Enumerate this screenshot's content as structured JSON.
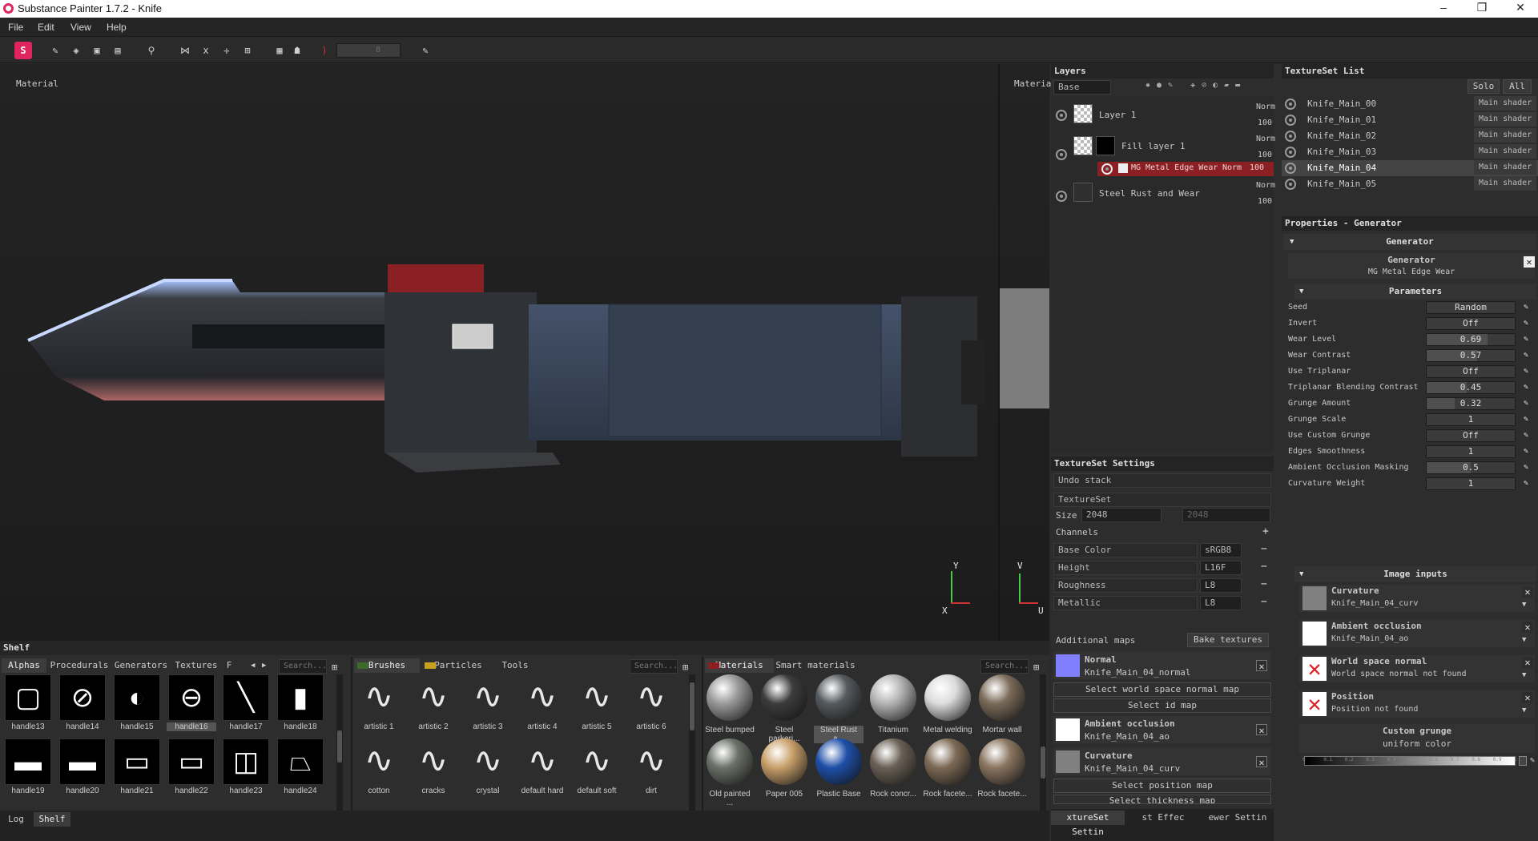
{
  "window": {
    "title": "Substance Painter 1.7.2 - Knife",
    "minimize": "–",
    "maximize": "❐",
    "close": "✕"
  },
  "menu": {
    "file": "File",
    "edit": "Edit",
    "view": "View",
    "help": "Help"
  },
  "toolbar": {
    "size_value": "8"
  },
  "viewport": {
    "left_label": "Material",
    "right_label": "Materia",
    "axis_y": "Y",
    "axis_x": "X",
    "axis_v": "V",
    "axis_u": "U"
  },
  "layers": {
    "title": "Layers",
    "channel": "Base Color",
    "items": [
      {
        "name": "Layer 1",
        "blend": "Norm",
        "opacity": "100"
      },
      {
        "name": "Fill layer 1",
        "blend": "Norm",
        "opacity": "100"
      },
      {
        "name": "MG Metal Edge Wear",
        "blend": "Norm",
        "opacity": "100"
      },
      {
        "name": "Steel Rust and Wear",
        "blend": "Norm",
        "opacity": "100"
      }
    ]
  },
  "textureset_list": {
    "title": "TextureSet List",
    "solo": "Solo",
    "all": "All",
    "items": [
      {
        "name": "Knife_Main_00",
        "shader": "Main shader"
      },
      {
        "name": "Knife_Main_01",
        "shader": "Main shader"
      },
      {
        "name": "Knife_Main_02",
        "shader": "Main shader"
      },
      {
        "name": "Knife_Main_03",
        "shader": "Main shader"
      },
      {
        "name": "Knife_Main_04",
        "shader": "Main shader"
      },
      {
        "name": "Knife_Main_05",
        "shader": "Main shader"
      }
    ]
  },
  "tss": {
    "title": "TextureSet Settings",
    "undo": "Undo stack",
    "textureset": "TextureSet",
    "size_label": "Size",
    "size": "2048",
    "size2": "2048",
    "channels_label": "Channels",
    "channels": [
      {
        "name": "Base Color",
        "format": "sRGB8"
      },
      {
        "name": "Height",
        "format": "L16F"
      },
      {
        "name": "Roughness",
        "format": "L8"
      },
      {
        "name": "Metallic",
        "format": "L8"
      }
    ],
    "additional": "Additional maps",
    "bake": "Bake textures",
    "maps": [
      {
        "title": "Normal",
        "file": "Knife_Main_04_normal",
        "color": "#7f7fff"
      },
      {
        "title": "Ambient occlusion",
        "file": "Knife_Main_04_ao",
        "color": "#ffffff"
      },
      {
        "title": "Curvature",
        "file": "Knife_Main_04_curv",
        "color": "#808080"
      }
    ],
    "select_wsn": "Select world space normal map",
    "select_id": "Select id map",
    "select_pos": "Select position map",
    "select_thick": "Select thickness map",
    "bottom_tabs": [
      "xtureSet Settin",
      "st Effec",
      "ewer Settin"
    ]
  },
  "props": {
    "title": "Properties - Generator",
    "generator_section": "Generator",
    "generator_label": "Generator",
    "generator_name": "MG Metal Edge Wear",
    "parameters": "Parameters",
    "params": [
      {
        "label": "Seed",
        "value": "Random",
        "level": 0
      },
      {
        "label": "Invert",
        "value": "Off",
        "level": 0
      },
      {
        "label": "Wear Level",
        "value": "0.69",
        "level": 0.69
      },
      {
        "label": "Wear Contrast",
        "value": "0.57",
        "level": 0.57
      },
      {
        "label": "Use Triplanar",
        "value": "Off",
        "level": 0
      },
      {
        "label": "Triplanar Blending Contrast",
        "value": "0.45",
        "level": 0.45
      },
      {
        "label": "Grunge Amount",
        "value": "0.32",
        "level": 0.32
      },
      {
        "label": "Grunge Scale",
        "value": "1",
        "level": 0
      },
      {
        "label": "Use Custom Grunge",
        "value": "Off",
        "level": 0
      },
      {
        "label": "Edges Smoothness",
        "value": "1",
        "level": 0
      },
      {
        "label": "Ambient Occlusion Masking",
        "value": "0.5",
        "level": 0.5
      },
      {
        "label": "Curvature Weight",
        "value": "1",
        "level": 0
      }
    ],
    "image_inputs": "Image inputs",
    "inputs": [
      {
        "title": "Curvature",
        "file": "Knife_Main_04_curv",
        "color": "#808080"
      },
      {
        "title": "Ambient occlusion",
        "file": "Knife_Main_04_ao",
        "color": "#ffffff"
      },
      {
        "title": "World space normal",
        "file": "World space normal not found",
        "color": "missing"
      },
      {
        "title": "Position",
        "file": "Position not found",
        "color": "missing"
      }
    ],
    "custom_grunge": "Custom grunge",
    "uniform_color": "uniform color",
    "ramp_ticks": [
      "0",
      "0.1",
      "0.2",
      "0.3",
      "0.4",
      "0.5",
      "0.6",
      "0.7",
      "0.8",
      "0.9",
      "1"
    ]
  },
  "shelf": {
    "title": "Shelf",
    "tabs1": [
      "Alphas",
      "Procedurals",
      "Generators",
      "Textures",
      "F"
    ],
    "search": "Search...",
    "alphas": [
      "handle13",
      "handle14",
      "handle15",
      "handle16",
      "handle17",
      "handle18",
      "handle19",
      "handle20",
      "handle21",
      "handle22",
      "handle23",
      "handle24"
    ],
    "tabs2": [
      "Brushes",
      "Particles",
      "Tools"
    ],
    "brushes": [
      "artistic 1",
      "artistic 2",
      "artistic 3",
      "artistic 4",
      "artistic 5",
      "artistic 6",
      "cotton",
      "cracks",
      "crystal",
      "default hard",
      "default soft",
      "dirt"
    ],
    "tabs3": [
      "Materials",
      "Smart materials"
    ],
    "materials": [
      {
        "name": "Steel bumped",
        "color": "#9a9a9a"
      },
      {
        "name": "Steel parkeri...",
        "color": "#3c3c3c"
      },
      {
        "name": "Steel Rust a...",
        "color": "#555a5e"
      },
      {
        "name": "Titanium",
        "color": "#b4b4b4"
      },
      {
        "name": "Metal welding",
        "color": "#dcdcdc"
      },
      {
        "name": "Mortar wall",
        "color": "#7a6a58"
      },
      {
        "name": "Old painted ...",
        "color": "#6b7068"
      },
      {
        "name": "Paper 005",
        "color": "#c8a06a"
      },
      {
        "name": "Plastic Base",
        "color": "#1e4fa8"
      },
      {
        "name": "Rock concr...",
        "color": "#6a6055"
      },
      {
        "name": "Rock facete...",
        "color": "#7d6a55"
      },
      {
        "name": "Rock facete...",
        "color": "#8a7560"
      }
    ],
    "bottom_tabs": [
      "Log",
      "Shelf"
    ]
  }
}
